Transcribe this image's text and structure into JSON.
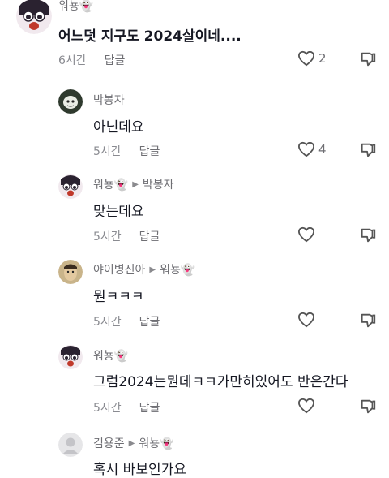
{
  "comments": [
    {
      "user": "워뇽👻",
      "text": "어느덧 지구도 2024살이네....",
      "time": "6시간",
      "reply": "답글",
      "likes": "2"
    },
    {
      "user": "박봉자",
      "text": "아닌데요",
      "time": "5시간",
      "reply": "답글",
      "likes": "4"
    },
    {
      "user": "워뇽👻",
      "reply_to": "박봉자",
      "text": "맞는데요",
      "time": "5시간",
      "reply": "답글",
      "likes": ""
    },
    {
      "user": "야이병진아",
      "reply_to": "워뇽👻",
      "text": "뭔ㅋㅋㅋ",
      "time": "5시간",
      "reply": "답글",
      "likes": ""
    },
    {
      "user": "워뇽👻",
      "text": "그럼2024는뭔데ㅋㅋ가만히있어도 반은간다",
      "time": "5시간",
      "reply": "답글",
      "likes": ""
    },
    {
      "user": "김용준",
      "reply_to": "워뇽👻",
      "text": "혹시 바보인가요",
      "time": "",
      "reply": "",
      "likes": ""
    }
  ],
  "icons": {
    "like": "heart-icon",
    "dislike": "thumbs-down-icon",
    "reply_arrow": "triangle-right-icon"
  },
  "colors": {
    "highlight": "#e02424",
    "text": "#161823",
    "muted": "#8a8b91"
  }
}
